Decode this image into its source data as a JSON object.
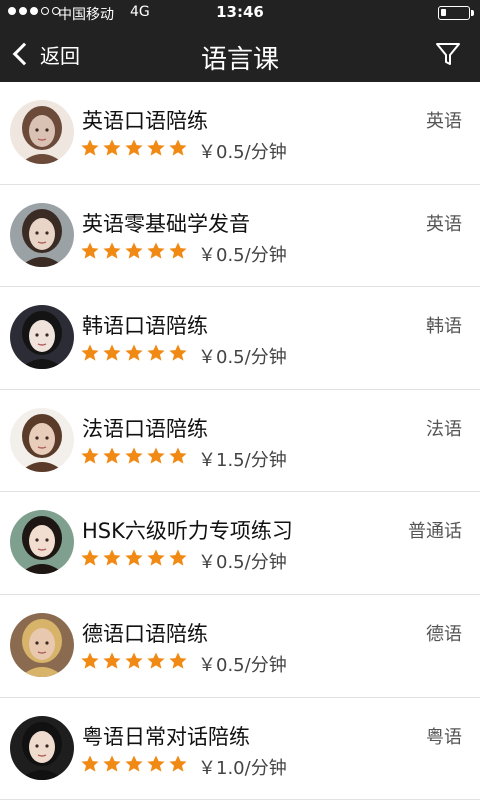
{
  "status_bar": {
    "carrier": "中国移动",
    "network": "4G",
    "time": "13:46",
    "signal_bars_filled": 3,
    "signal_bars_total": 5,
    "battery_level": 0.2
  },
  "nav": {
    "back_label": "返回",
    "title": "语言课",
    "filter_icon": "filter-icon"
  },
  "colors": {
    "bar_bg": "#222222",
    "star": "#f08a14"
  },
  "courses": [
    {
      "title": "英语口语陪练",
      "tag": "英语",
      "price": "￥0.5/分钟",
      "rating": 5,
      "avatar_colors": [
        "#d9c2b4",
        "#6b4a3a",
        "#efe6df"
      ]
    },
    {
      "title": "英语零基础学发音",
      "tag": "英语",
      "price": "￥0.5/分钟",
      "rating": 5,
      "avatar_colors": [
        "#e8d5c8",
        "#3a2b24",
        "#9ba2a6"
      ]
    },
    {
      "title": "韩语口语陪练",
      "tag": "韩语",
      "price": "￥0.5/分钟",
      "rating": 5,
      "avatar_colors": [
        "#f0e3dc",
        "#141414",
        "#2c2c36"
      ]
    },
    {
      "title": "法语口语陪练",
      "tag": "法语",
      "price": "￥1.5/分钟",
      "rating": 5,
      "avatar_colors": [
        "#e9cdbb",
        "#5a3b2a",
        "#f3efea"
      ]
    },
    {
      "title": "HSK六级听力专项练习",
      "tag": "普通话",
      "price": "￥0.5/分钟",
      "rating": 5,
      "avatar_colors": [
        "#f2ddd1",
        "#1d1612",
        "#7fa08e"
      ]
    },
    {
      "title": "德语口语陪练",
      "tag": "德语",
      "price": "￥0.5/分钟",
      "rating": 5,
      "avatar_colors": [
        "#e8c9b0",
        "#d8b46a",
        "#8a6b4f"
      ]
    },
    {
      "title": "粤语日常对话陪练",
      "tag": "粤语",
      "price": "￥1.0/分钟",
      "rating": 5,
      "avatar_colors": [
        "#f0dccf",
        "#111111",
        "#1e1e1e"
      ]
    }
  ]
}
